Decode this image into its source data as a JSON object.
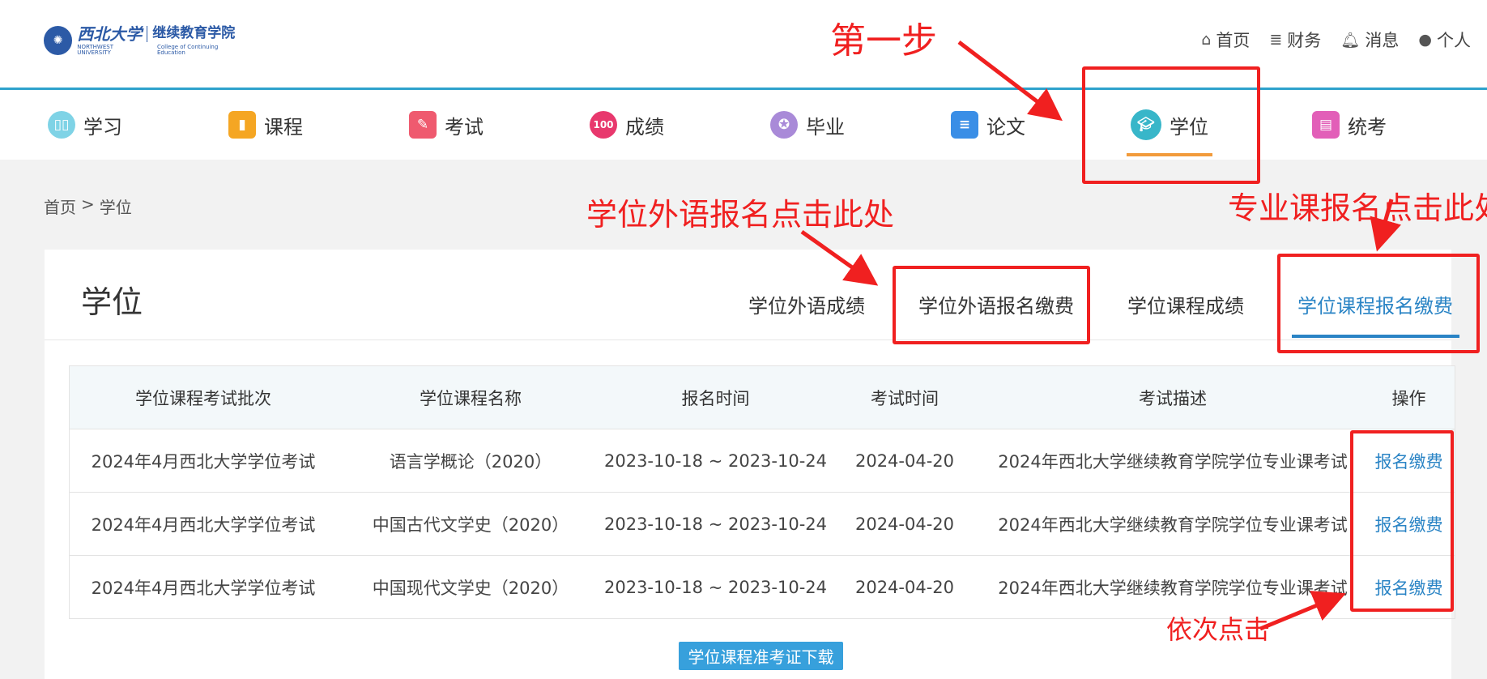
{
  "header": {
    "logo": {
      "university_cn": "西北大学",
      "college_cn": "继续教育学院",
      "university_en": "NORTHWEST UNIVERSITY",
      "college_en": "College of Continuing Education"
    },
    "topnav": [
      {
        "label": "首页",
        "icon": "home-icon"
      },
      {
        "label": "财务",
        "icon": "database-icon"
      },
      {
        "label": "消息",
        "icon": "bell-icon"
      },
      {
        "label": "个人",
        "icon": "user-icon"
      }
    ]
  },
  "mainnav": {
    "items": [
      {
        "label": "学习",
        "icon": "book-open-icon",
        "color": "#7fd3e6"
      },
      {
        "label": "课程",
        "icon": "bookmark-icon",
        "color": "#f5a623"
      },
      {
        "label": "考试",
        "icon": "pencil-icon",
        "color": "#ef5a6f"
      },
      {
        "label": "成绩",
        "icon": "score-100-icon",
        "color": "#e8386d"
      },
      {
        "label": "毕业",
        "icon": "certificate-icon",
        "color": "#a98ad8"
      },
      {
        "label": "论文",
        "icon": "document-icon",
        "color": "#3a8ee6"
      },
      {
        "label": "学位",
        "icon": "graduation-cap-icon",
        "color": "#38b6c9"
      },
      {
        "label": "统考",
        "icon": "exam-folder-icon",
        "color": "#e25fb8"
      }
    ],
    "active": "学位",
    "active_color": "#f29b3b"
  },
  "breadcrumb": {
    "home": "首页",
    "sep": ">",
    "current": "学位"
  },
  "panel": {
    "title": "学位",
    "tabs": [
      {
        "label": "学位外语成绩"
      },
      {
        "label": "学位外语报名缴费"
      },
      {
        "label": "学位课程成绩"
      },
      {
        "label": "学位课程报名缴费"
      }
    ],
    "active_tab": "学位课程报名缴费",
    "accent": "#2a84c5"
  },
  "table": {
    "headers": [
      "学位课程考试批次",
      "学位课程名称",
      "报名时间",
      "考试时间",
      "考试描述",
      "操作"
    ],
    "rows": [
      [
        "2024年4月西北大学学位考试",
        "语言学概论（2020）",
        "2023-10-18 ~ 2023-10-24",
        "2024-04-20",
        "2024年西北大学继续教育学院学位专业课考试",
        "报名缴费"
      ],
      [
        "2024年4月西北大学学位考试",
        "中国古代文学史（2020）",
        "2023-10-18 ~ 2023-10-24",
        "2024-04-20",
        "2024年西北大学继续教育学院学位专业课考试",
        "报名缴费"
      ],
      [
        "2024年4月西北大学学位考试",
        "中国现代文学史（2020）",
        "2023-10-18 ~ 2023-10-24",
        "2024-04-20",
        "2024年西北大学继续教育学院学位专业课考试",
        "报名缴费"
      ]
    ]
  },
  "download_button": "学位课程准考证下载",
  "annotations": {
    "step1": "第一步",
    "foreign_lang": "学位外语报名点击此处",
    "major_course": "专业课报名点击此处",
    "in_order": "依次点击",
    "color": "#f02020"
  }
}
